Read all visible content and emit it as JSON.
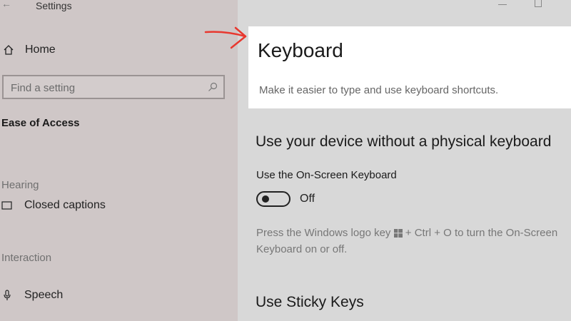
{
  "window": {
    "app_title": "Settings",
    "back_glyph": "←"
  },
  "sidebar": {
    "home_label": "Home",
    "search": {
      "placeholder": "Find a setting"
    },
    "section_title": "Ease of Access",
    "groups": [
      {
        "label": "Hearing",
        "items": [
          {
            "label": "Closed captions",
            "icon": "closed-captions-icon"
          }
        ]
      },
      {
        "label": "Interaction",
        "items": [
          {
            "label": "Speech",
            "icon": "microphone-icon"
          }
        ]
      }
    ]
  },
  "main": {
    "title": "Keyboard",
    "description": "Make it easier to type and use keyboard shortcuts.",
    "section1_heading": "Use your device without a physical keyboard",
    "onscreen_label": "Use the On-Screen Keyboard",
    "onscreen_state": "Off",
    "help_text_before": "Press the Windows logo key",
    "help_text_after": "+ Ctrl + O to turn the On-Screen Keyboard on or off.",
    "section2_heading": "Use Sticky Keys"
  },
  "colors": {
    "sidebar_bg": "#cfc7c7",
    "main_bg": "#d8d8d8",
    "header_card": "#ffffff",
    "annotation_arrow": "#e8382f"
  }
}
